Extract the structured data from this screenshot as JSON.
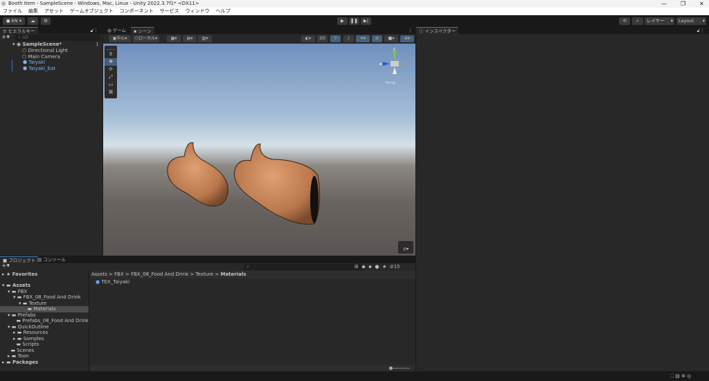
{
  "window": {
    "title": "Booth Item - SampleScene - Windows, Mac, Linux - Unity 2022.3.7f1* <DX11>"
  },
  "menu": [
    "ファイル",
    "編集",
    "アセット",
    "ゲームオブジェクト",
    "コンポーネント",
    "サービス",
    "ウィンドウ",
    "ヘルプ"
  ],
  "toolbar": {
    "account": "KN",
    "layers": "レイヤー",
    "layout": "Layout"
  },
  "hierarchy": {
    "tab": "ヒエラルキー",
    "search_placeholder": "All",
    "scene": "SampleScene*",
    "items": [
      {
        "label": "Directional Light",
        "prefab": false
      },
      {
        "label": "Main Camera",
        "prefab": false
      },
      {
        "label": "Taiyaki",
        "prefab": true
      },
      {
        "label": "Taiyaki_Eat",
        "prefab": true
      }
    ]
  },
  "scene_view": {
    "tabs": [
      "ゲーム",
      "シーン"
    ],
    "active_tab": "シーン",
    "pivot": "中心",
    "space": "ローカル",
    "mode_2d": "2D",
    "gizmo_axes": {
      "y": "y",
      "z": "z"
    },
    "projection": "Persp"
  },
  "inspector": {
    "tab": "インスペクター"
  },
  "project": {
    "tabs": [
      "プロジェクト",
      "コンソール"
    ],
    "favorites": "Favorites",
    "tree": [
      {
        "label": "Assets",
        "depth": 0,
        "bold": true
      },
      {
        "label": "FBX",
        "depth": 1
      },
      {
        "label": "FBX_08_Food And Drink",
        "depth": 2
      },
      {
        "label": "Texture",
        "depth": 3
      },
      {
        "label": "Materials",
        "depth": 4,
        "selected": true
      },
      {
        "label": "Prefabs",
        "depth": 1
      },
      {
        "label": "Prefabs_08_Food And Drink",
        "depth": 2
      },
      {
        "label": "QuickOutline",
        "depth": 1
      },
      {
        "label": "Resources",
        "depth": 2
      },
      {
        "label": "Samples",
        "depth": 2
      },
      {
        "label": "Scripts",
        "depth": 2
      },
      {
        "label": "Scenes",
        "depth": 1
      },
      {
        "label": "Toon",
        "depth": 1
      },
      {
        "label": "Packages",
        "depth": 0,
        "bold": true
      }
    ],
    "breadcrumb": [
      "Assets",
      "FBX",
      "FBX_08_Food And Drink",
      "Texture",
      "Materials"
    ],
    "files": [
      "TEX_Taiyaki"
    ],
    "hidden_count": "15"
  },
  "colors": {
    "accent": "#3a79bb",
    "prefab": "#7cb6f0",
    "taiyaki": "#c98a5a"
  }
}
